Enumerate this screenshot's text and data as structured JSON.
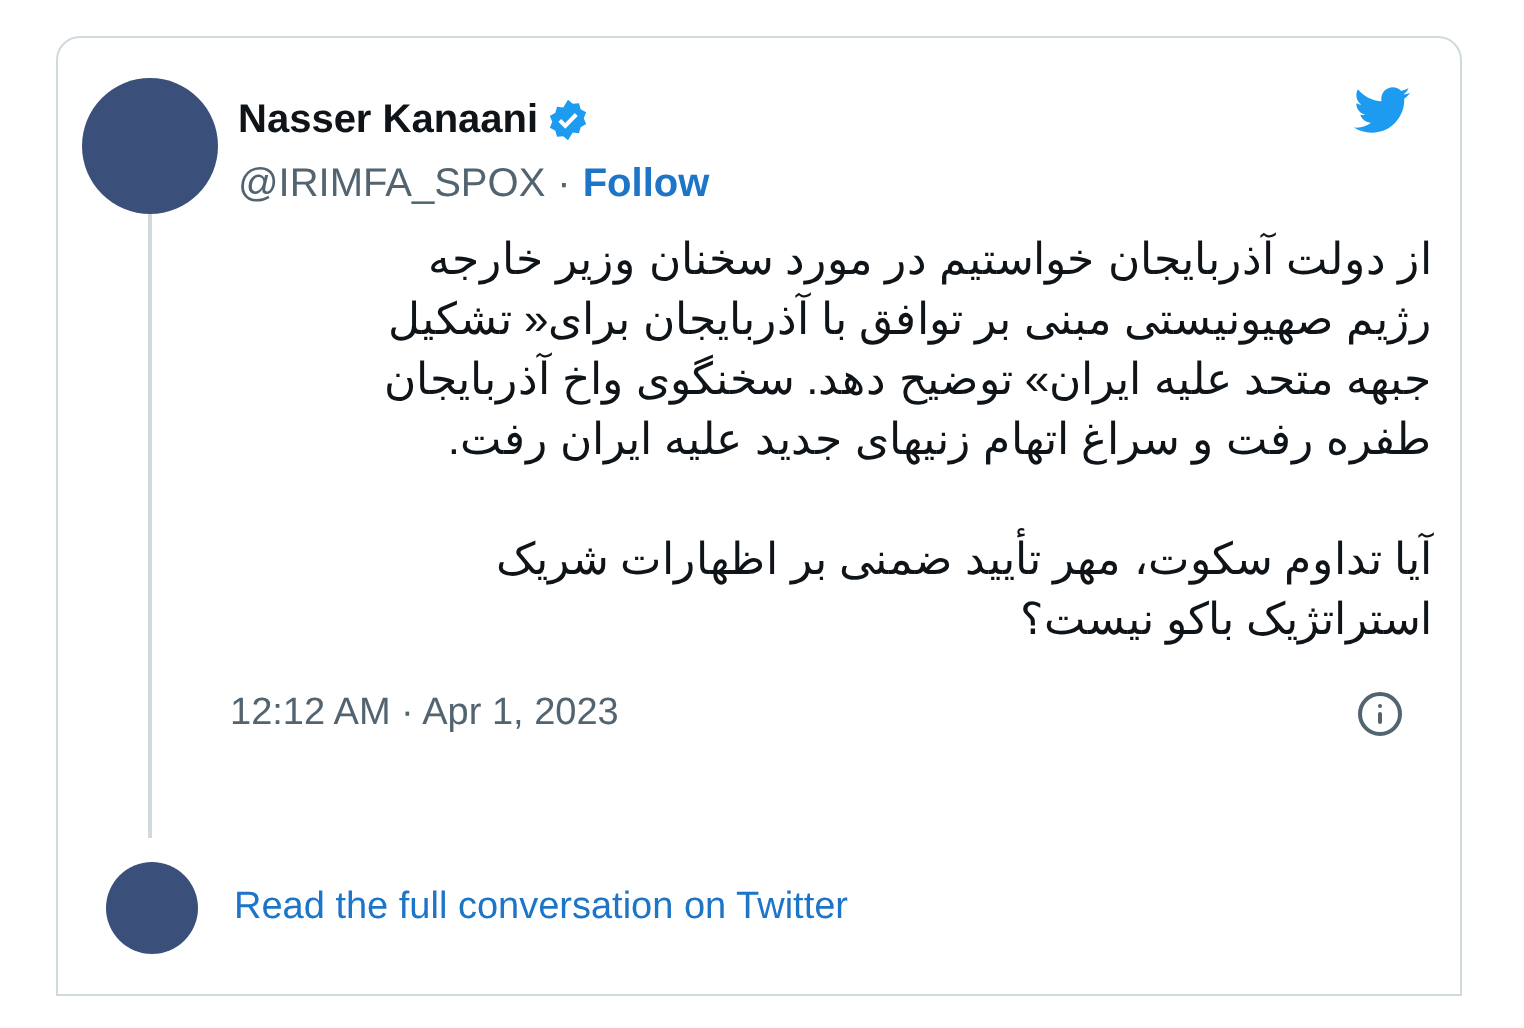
{
  "author": {
    "name": "Nasser Kanaani",
    "verified": true,
    "handle": "@IRIMFA_SPOX",
    "separator": "·",
    "follow": "Follow"
  },
  "paragraphs": [
    [
      "از دولت آذربایجان خواستیم در مورد سخنان وزیر خارجه",
      "رژیم صهیونیستی مبنی بر توافق با آذربایجان برای« تشکیل",
      "جبهه متحد علیه ایران» توضیح دهد. سخنگوی واخ آذربایجان",
      "طفره رفت و سراغ اتهام زنیهای جدید علیه ایران رفت."
    ],
    [
      "آیا تداوم سکوت، مهر تأیید ضمنی بر اظهارات شریک",
      "استراتژیک باکو نیست؟"
    ]
  ],
  "timestamp": "12:12 AM · Apr 1, 2023",
  "conversation_link": "Read the full conversation on Twitter"
}
